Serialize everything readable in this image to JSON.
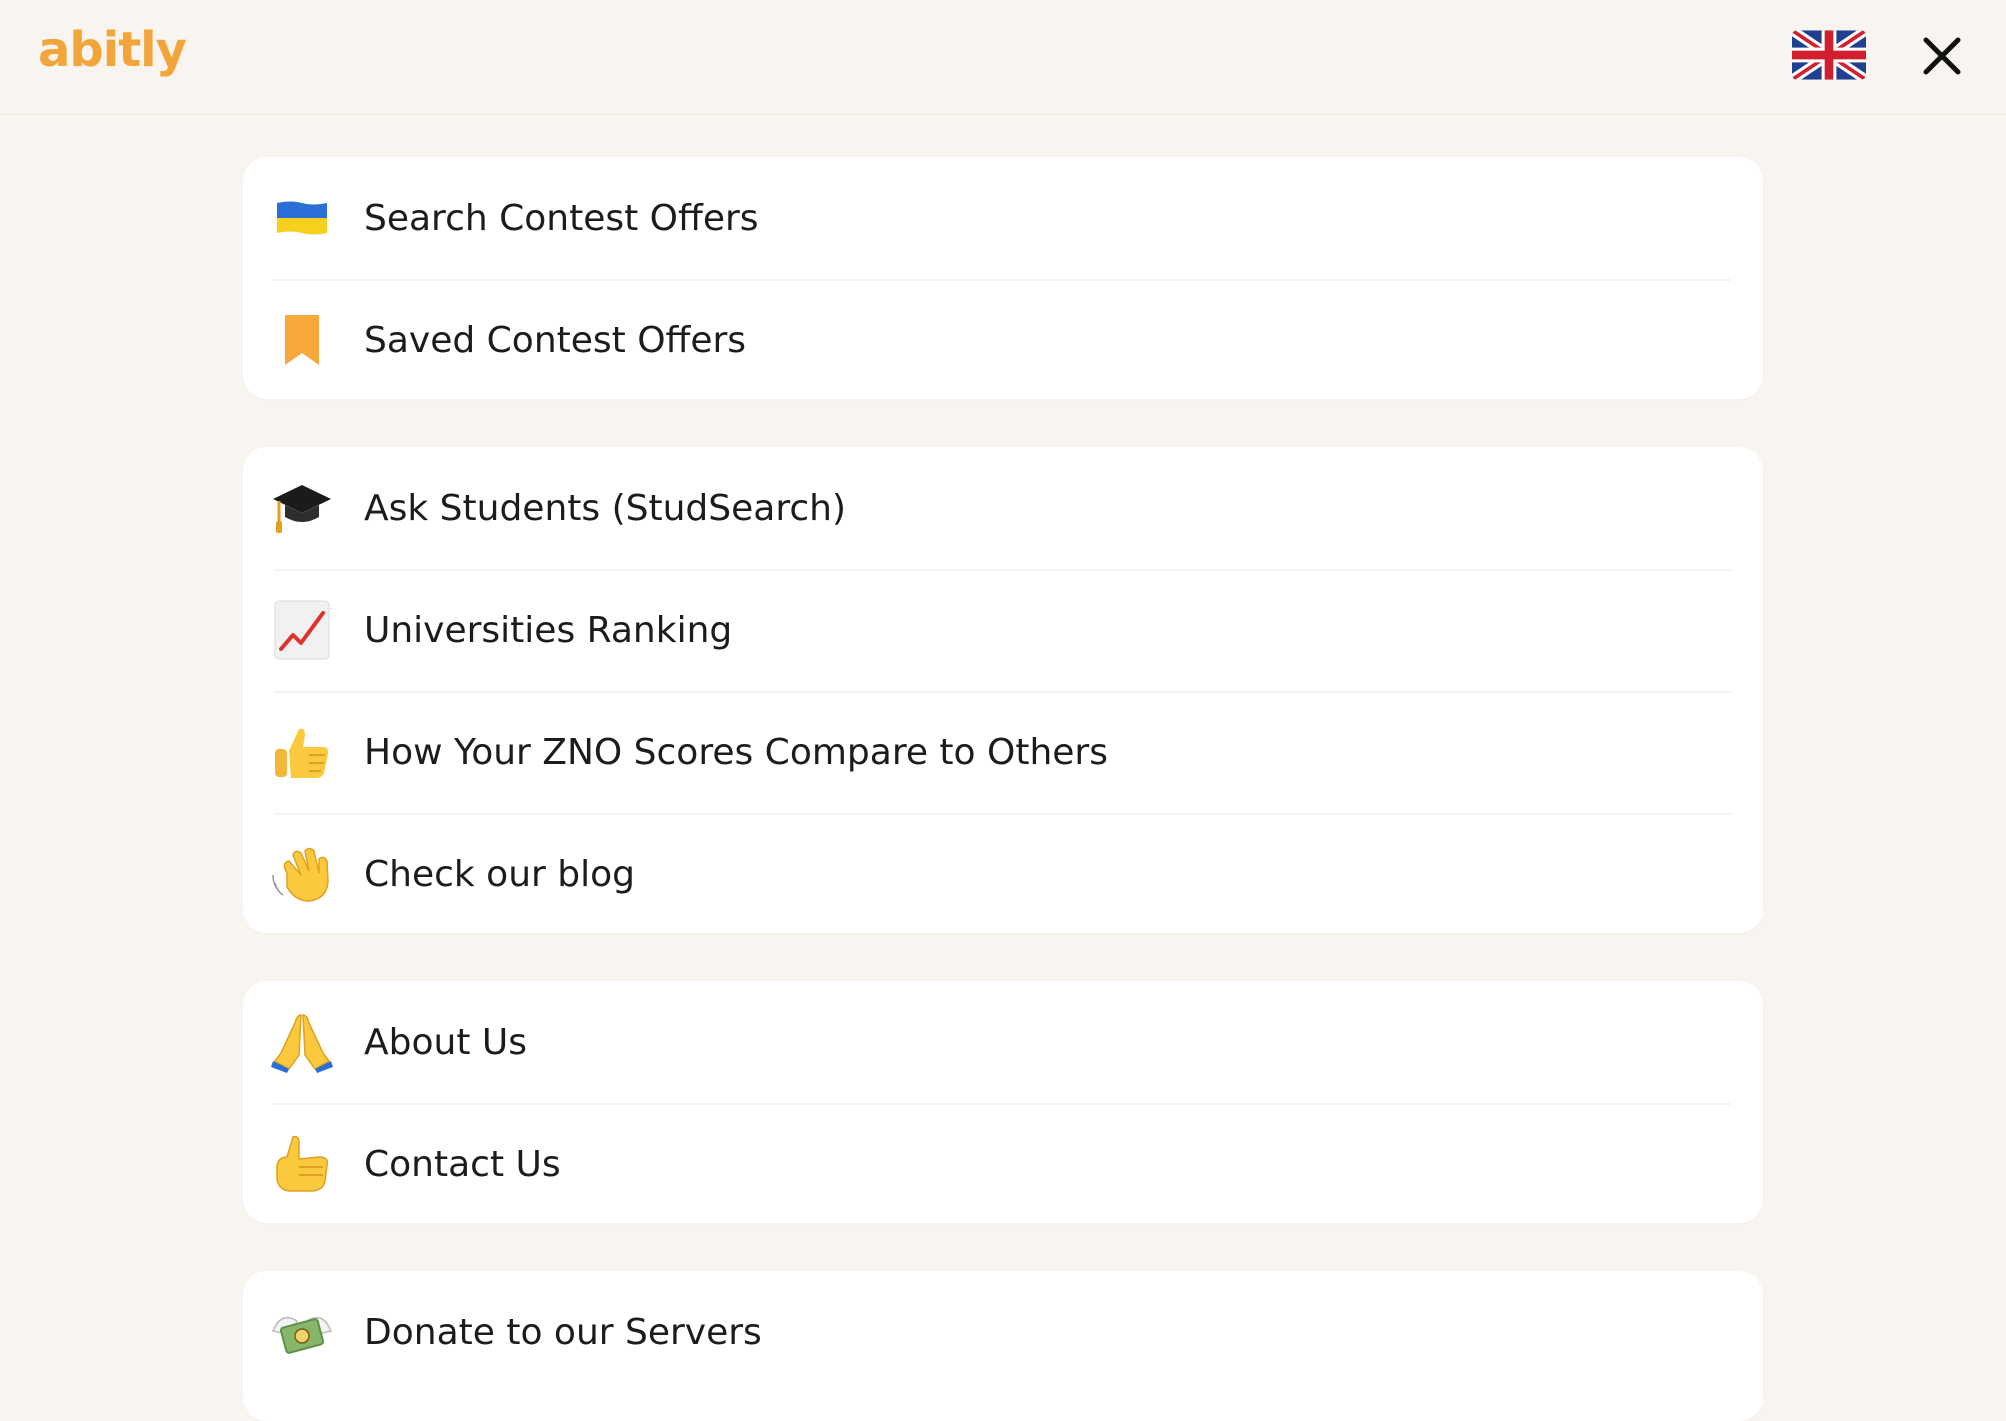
{
  "header": {
    "logo_text": "abitly",
    "language_flag": "uk-flag-icon",
    "close_icon": "close-icon"
  },
  "menu": {
    "groups": [
      {
        "items": [
          {
            "label": "Search Contest Offers",
            "icon": "ukraine-flag-icon"
          },
          {
            "label": "Saved Contest Offers",
            "icon": "bookmark-icon"
          }
        ]
      },
      {
        "items": [
          {
            "label": "Ask Students (StudSearch)",
            "icon": "graduation-cap-icon"
          },
          {
            "label": "Universities Ranking",
            "icon": "chart-increasing-icon"
          },
          {
            "label": "How Your ZNO Scores Compare to Others",
            "icon": "thumbs-up-icon"
          },
          {
            "label": "Check our blog",
            "icon": "waving-hand-icon"
          }
        ]
      },
      {
        "items": [
          {
            "label": "About Us",
            "icon": "folded-hands-icon"
          },
          {
            "label": "Contact Us",
            "icon": "call-me-hand-icon"
          }
        ]
      },
      {
        "items": [
          {
            "label": "Donate to our Servers",
            "icon": "money-with-wings-icon"
          }
        ]
      }
    ]
  },
  "colors": {
    "background": "#f8f4ef",
    "card": "#ffffff",
    "brand": "#f2a53a",
    "text": "#1c1c1c"
  }
}
